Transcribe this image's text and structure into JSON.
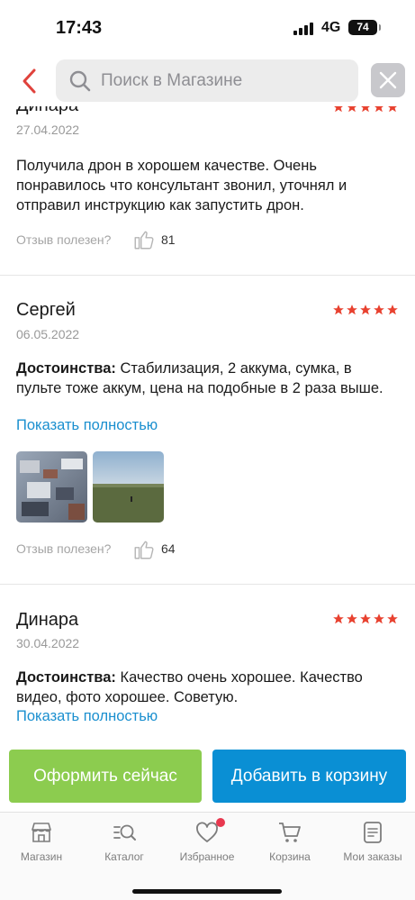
{
  "status_bar": {
    "time": "17:43",
    "network": "4G",
    "battery": "74"
  },
  "search": {
    "placeholder": "Поиск в Магазине"
  },
  "colors": {
    "accent": "#e0423c",
    "link": "#1a8fcf",
    "checkout": "#8ccc4f",
    "cart": "#0a8fd4",
    "star": "#e8412f"
  },
  "reviews": [
    {
      "author": "Динара",
      "date": "27.04.2022",
      "rating": 5,
      "text": "Получила дрон в хорошем качестве. Очень понравилось что консультант звонил, уточнял и отправил инструкцию как запустить дрон.",
      "helpful_label": "Отзыв полезен?",
      "likes": "81"
    },
    {
      "author": "Сергей",
      "date": "06.05.2022",
      "rating": 5,
      "pros_label": "Достоинства:",
      "text": "Стабилизация, 2 аккума, сумка, в пульте тоже аккум, цена на подобные в 2 раза выше.",
      "show_more": "Показать полностью",
      "photos": [
        "aerial-photo",
        "field-photo"
      ],
      "helpful_label": "Отзыв полезен?",
      "likes": "64"
    },
    {
      "author": "Динара",
      "date": "30.04.2022",
      "rating": 5,
      "pros_label": "Достоинства:",
      "text": "Качество очень хорошее. Качество видео, фото хорошее. Советую.",
      "show_more": "Показать полностью"
    }
  ],
  "actions": {
    "checkout": "Оформить сейчас",
    "add_to_cart": "Добавить в корзину"
  },
  "tabs": [
    {
      "label": "Магазин",
      "icon": "store-icon"
    },
    {
      "label": "Каталог",
      "icon": "catalog-search-icon"
    },
    {
      "label": "Избранное",
      "icon": "heart-icon",
      "badge": true
    },
    {
      "label": "Корзина",
      "icon": "cart-icon"
    },
    {
      "label": "Мои заказы",
      "icon": "orders-icon"
    }
  ]
}
